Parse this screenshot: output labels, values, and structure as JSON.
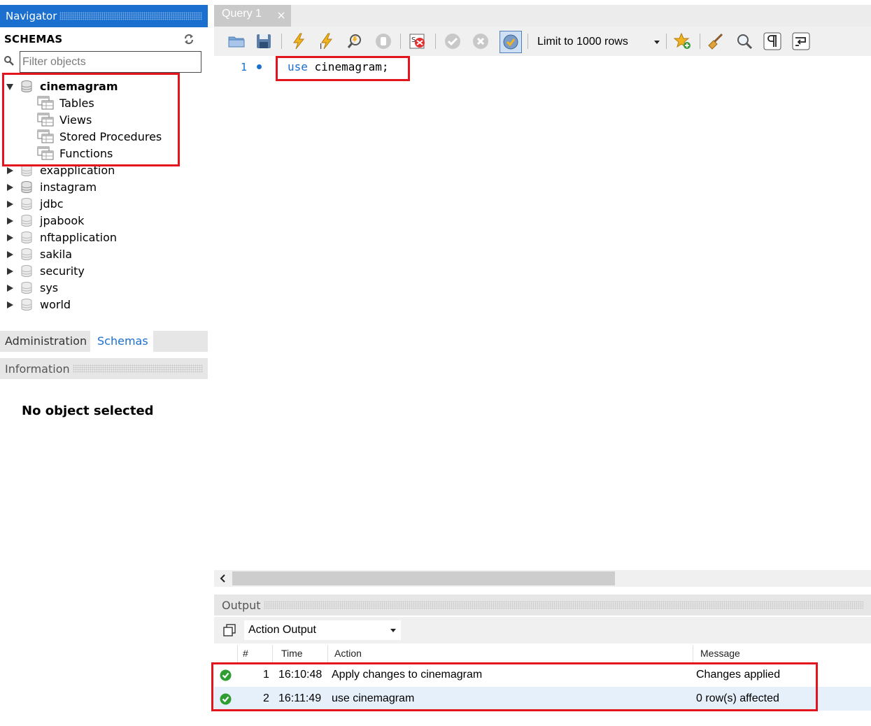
{
  "navigator": {
    "title": "Navigator",
    "schemas_title": "SCHEMAS",
    "filter_placeholder": "Filter objects",
    "expanded_schema": {
      "name": "cinemagram",
      "children": [
        "Tables",
        "Views",
        "Stored Procedures",
        "Functions"
      ]
    },
    "schemas": [
      "exapplication",
      "instagram",
      "jdbc",
      "jpabook",
      "nftapplication",
      "sakila",
      "security",
      "sys",
      "world"
    ],
    "bottom_tabs": {
      "administration": "Administration",
      "schemas": "Schemas"
    },
    "information": {
      "title": "Information",
      "empty_message": "No object selected"
    }
  },
  "editor": {
    "tab_label": "Query 1",
    "toolbar": {
      "limit_label": "Limit to 1000 rows"
    },
    "lines": [
      {
        "number": "1",
        "keyword": "use",
        "rest": " cinemagram;"
      }
    ]
  },
  "output": {
    "title": "Output",
    "mode_label": "Action Output",
    "columns": {
      "num": "#",
      "time": "Time",
      "action": "Action",
      "message": "Message"
    },
    "rows": [
      {
        "num": "1",
        "time": "16:10:48",
        "action": "Apply changes to cinemagram",
        "message": "Changes applied",
        "status": "success"
      },
      {
        "num": "2",
        "time": "16:11:49",
        "action": "use cinemagram",
        "message": "0 row(s) affected",
        "status": "success"
      }
    ]
  },
  "colors": {
    "accent": "#1a6fcf",
    "highlight_box": "#e3141e",
    "success": "#2e9e32"
  }
}
